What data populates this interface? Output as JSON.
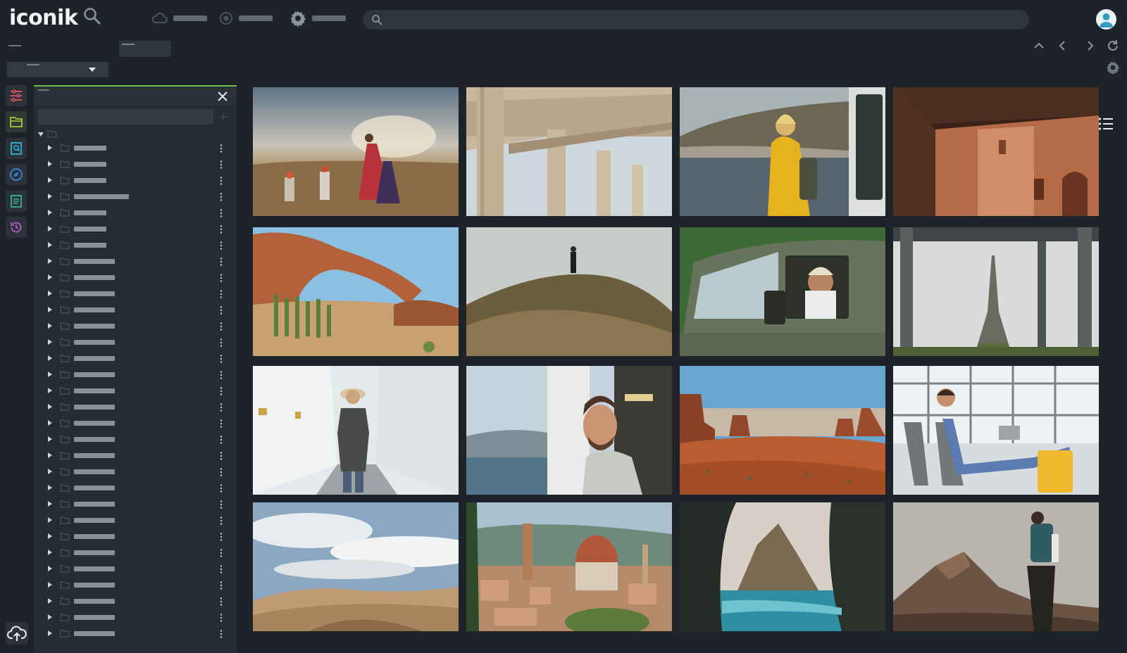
{
  "app": {
    "logo_text": "iconik",
    "accent_color": "#6abf4b"
  },
  "header": {
    "search_icon": "search-icon",
    "nav": [
      {
        "icon": "cloud-icon",
        "label": ""
      },
      {
        "icon": "target-icon",
        "label": ""
      },
      {
        "icon": "gear-icon",
        "label": ""
      }
    ],
    "global_search": {
      "placeholder": "",
      "icon": "search-icon"
    },
    "avatar_icon": "user-avatar-icon"
  },
  "toolbar": {
    "breadcrumb": "",
    "tab_label": "",
    "view_select_value": "",
    "icons": [
      "chevron-up-icon",
      "chevron-left-icon",
      "chevron-right-icon",
      "refresh-icon",
      "gear-icon"
    ]
  },
  "sidebar_rail": {
    "items": [
      {
        "icon": "sliders-icon",
        "color": "#e0555f"
      },
      {
        "icon": "folder-icon",
        "color": "#a8c93a"
      },
      {
        "icon": "saved-search-icon",
        "color": "#2bb5d8"
      },
      {
        "icon": "compass-icon",
        "color": "#3d84e0"
      },
      {
        "icon": "document-icon",
        "color": "#35b78a"
      },
      {
        "icon": "history-icon",
        "color": "#b05ec9"
      }
    ],
    "upload_icon": "cloud-upload-icon"
  },
  "collections_panel": {
    "title": "",
    "filter_placeholder": "",
    "items": [
      "",
      "",
      "",
      "",
      "",
      "",
      "",
      "",
      "",
      "",
      "",
      "",
      "",
      "",
      "",
      "",
      "",
      "",
      "",
      "",
      "",
      "",
      "",
      "",
      "",
      "",
      "",
      "",
      "",
      "",
      ""
    ]
  },
  "grid": {
    "view_icons": [
      "grid-view-icon",
      "list-view-icon"
    ],
    "tiles": [
      {
        "subject": "rajasthan-dancers"
      },
      {
        "subject": "greek-temple-columns"
      },
      {
        "subject": "woman-yellow-jacket-fjord"
      },
      {
        "subject": "adobe-building"
      },
      {
        "subject": "desert-rock-arch"
      },
      {
        "subject": "man-on-grassy-dune"
      },
      {
        "subject": "man-driving-van"
      },
      {
        "subject": "eiffel-tower-under-bridge"
      },
      {
        "subject": "woman-temple-walkway"
      },
      {
        "subject": "man-on-ferry"
      },
      {
        "subject": "monument-valley"
      },
      {
        "subject": "woman-airport-lounge"
      },
      {
        "subject": "sand-dunes-sky"
      },
      {
        "subject": "florence-cathedral"
      },
      {
        "subject": "sea-cliff-cove"
      },
      {
        "subject": "hiker-mountain-peak"
      }
    ]
  }
}
